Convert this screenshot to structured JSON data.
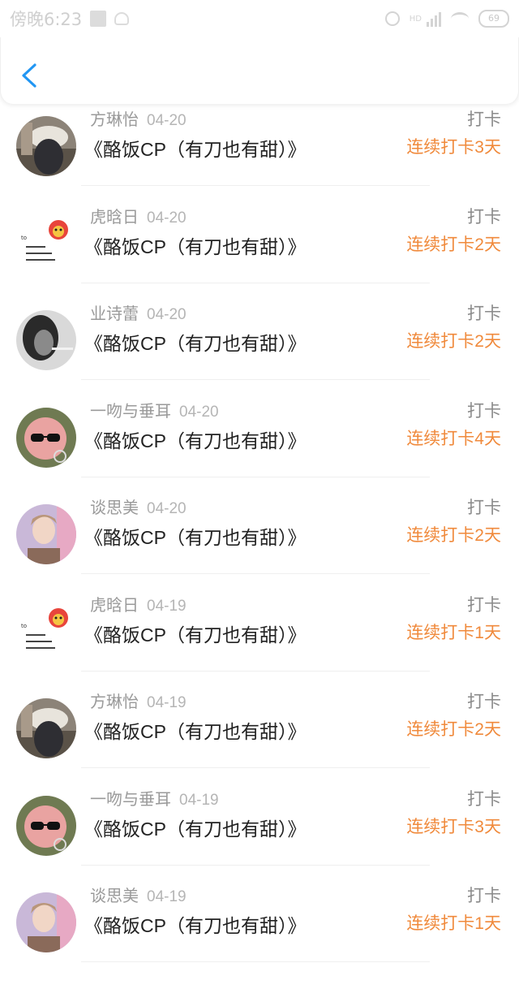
{
  "status_bar": {
    "time": "傍晚6:23",
    "battery": "69"
  },
  "nav": {
    "back_icon": "back-arrow-icon",
    "accent": "#2196f3"
  },
  "colors": {
    "streak": "#f08a3c"
  },
  "records": [
    {
      "name": "方琳怡",
      "date": "04-20",
      "title": "《酪饭CP（有刀也有甜）》",
      "type": "打卡",
      "streak": "连续打卡3天",
      "avatar": "photo-hat"
    },
    {
      "name": "虎晗日",
      "date": "04-20",
      "title": "《酪饭CP（有刀也有甜）》",
      "type": "打卡",
      "streak": "连续打卡2天",
      "avatar": "cartoon-cat"
    },
    {
      "name": "业诗蕾",
      "date": "04-20",
      "title": "《酪饭CP（有刀也有甜）》",
      "type": "打卡",
      "streak": "连续打卡2天",
      "avatar": "bw-portrait"
    },
    {
      "name": "一吻与垂耳",
      "date": "04-20",
      "title": "《酪饭CP（有刀也有甜）》",
      "type": "打卡",
      "streak": "连续打卡4天",
      "avatar": "pink-sunglasses"
    },
    {
      "name": "谈思美",
      "date": "04-20",
      "title": "《酪饭CP（有刀也有甜）》",
      "type": "打卡",
      "streak": "连续打卡2天",
      "avatar": "pastel-portrait"
    },
    {
      "name": "虎晗日",
      "date": "04-19",
      "title": "《酪饭CP（有刀也有甜）》",
      "type": "打卡",
      "streak": "连续打卡1天",
      "avatar": "cartoon-cat"
    },
    {
      "name": "方琳怡",
      "date": "04-19",
      "title": "《酪饭CP（有刀也有甜）》",
      "type": "打卡",
      "streak": "连续打卡2天",
      "avatar": "photo-hat"
    },
    {
      "name": "一吻与垂耳",
      "date": "04-19",
      "title": "《酪饭CP（有刀也有甜）》",
      "type": "打卡",
      "streak": "连续打卡3天",
      "avatar": "pink-sunglasses"
    },
    {
      "name": "谈思美",
      "date": "04-19",
      "title": "《酪饭CP（有刀也有甜）》",
      "type": "打卡",
      "streak": "连续打卡1天",
      "avatar": "pastel-portrait"
    }
  ]
}
